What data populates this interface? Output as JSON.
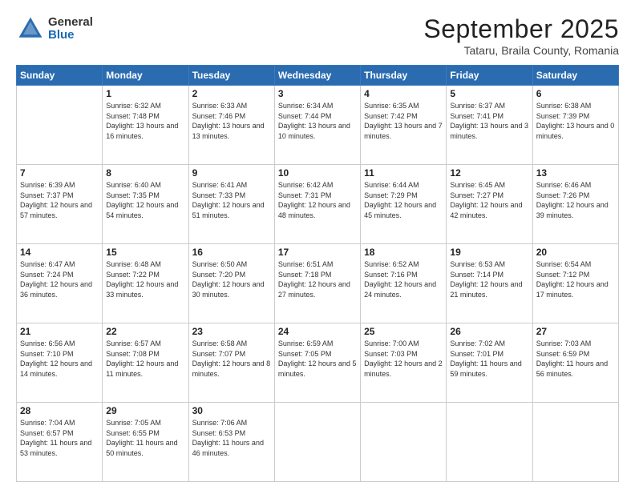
{
  "header": {
    "logo_general": "General",
    "logo_blue": "Blue",
    "month_title": "September 2025",
    "location": "Tataru, Braila County, Romania"
  },
  "weekdays": [
    "Sunday",
    "Monday",
    "Tuesday",
    "Wednesday",
    "Thursday",
    "Friday",
    "Saturday"
  ],
  "weeks": [
    [
      {
        "day": "",
        "sunrise": "",
        "sunset": "",
        "daylight": ""
      },
      {
        "day": "1",
        "sunrise": "Sunrise: 6:32 AM",
        "sunset": "Sunset: 7:48 PM",
        "daylight": "Daylight: 13 hours and 16 minutes."
      },
      {
        "day": "2",
        "sunrise": "Sunrise: 6:33 AM",
        "sunset": "Sunset: 7:46 PM",
        "daylight": "Daylight: 13 hours and 13 minutes."
      },
      {
        "day": "3",
        "sunrise": "Sunrise: 6:34 AM",
        "sunset": "Sunset: 7:44 PM",
        "daylight": "Daylight: 13 hours and 10 minutes."
      },
      {
        "day": "4",
        "sunrise": "Sunrise: 6:35 AM",
        "sunset": "Sunset: 7:42 PM",
        "daylight": "Daylight: 13 hours and 7 minutes."
      },
      {
        "day": "5",
        "sunrise": "Sunrise: 6:37 AM",
        "sunset": "Sunset: 7:41 PM",
        "daylight": "Daylight: 13 hours and 3 minutes."
      },
      {
        "day": "6",
        "sunrise": "Sunrise: 6:38 AM",
        "sunset": "Sunset: 7:39 PM",
        "daylight": "Daylight: 13 hours and 0 minutes."
      }
    ],
    [
      {
        "day": "7",
        "sunrise": "Sunrise: 6:39 AM",
        "sunset": "Sunset: 7:37 PM",
        "daylight": "Daylight: 12 hours and 57 minutes."
      },
      {
        "day": "8",
        "sunrise": "Sunrise: 6:40 AM",
        "sunset": "Sunset: 7:35 PM",
        "daylight": "Daylight: 12 hours and 54 minutes."
      },
      {
        "day": "9",
        "sunrise": "Sunrise: 6:41 AM",
        "sunset": "Sunset: 7:33 PM",
        "daylight": "Daylight: 12 hours and 51 minutes."
      },
      {
        "day": "10",
        "sunrise": "Sunrise: 6:42 AM",
        "sunset": "Sunset: 7:31 PM",
        "daylight": "Daylight: 12 hours and 48 minutes."
      },
      {
        "day": "11",
        "sunrise": "Sunrise: 6:44 AM",
        "sunset": "Sunset: 7:29 PM",
        "daylight": "Daylight: 12 hours and 45 minutes."
      },
      {
        "day": "12",
        "sunrise": "Sunrise: 6:45 AM",
        "sunset": "Sunset: 7:27 PM",
        "daylight": "Daylight: 12 hours and 42 minutes."
      },
      {
        "day": "13",
        "sunrise": "Sunrise: 6:46 AM",
        "sunset": "Sunset: 7:26 PM",
        "daylight": "Daylight: 12 hours and 39 minutes."
      }
    ],
    [
      {
        "day": "14",
        "sunrise": "Sunrise: 6:47 AM",
        "sunset": "Sunset: 7:24 PM",
        "daylight": "Daylight: 12 hours and 36 minutes."
      },
      {
        "day": "15",
        "sunrise": "Sunrise: 6:48 AM",
        "sunset": "Sunset: 7:22 PM",
        "daylight": "Daylight: 12 hours and 33 minutes."
      },
      {
        "day": "16",
        "sunrise": "Sunrise: 6:50 AM",
        "sunset": "Sunset: 7:20 PM",
        "daylight": "Daylight: 12 hours and 30 minutes."
      },
      {
        "day": "17",
        "sunrise": "Sunrise: 6:51 AM",
        "sunset": "Sunset: 7:18 PM",
        "daylight": "Daylight: 12 hours and 27 minutes."
      },
      {
        "day": "18",
        "sunrise": "Sunrise: 6:52 AM",
        "sunset": "Sunset: 7:16 PM",
        "daylight": "Daylight: 12 hours and 24 minutes."
      },
      {
        "day": "19",
        "sunrise": "Sunrise: 6:53 AM",
        "sunset": "Sunset: 7:14 PM",
        "daylight": "Daylight: 12 hours and 21 minutes."
      },
      {
        "day": "20",
        "sunrise": "Sunrise: 6:54 AM",
        "sunset": "Sunset: 7:12 PM",
        "daylight": "Daylight: 12 hours and 17 minutes."
      }
    ],
    [
      {
        "day": "21",
        "sunrise": "Sunrise: 6:56 AM",
        "sunset": "Sunset: 7:10 PM",
        "daylight": "Daylight: 12 hours and 14 minutes."
      },
      {
        "day": "22",
        "sunrise": "Sunrise: 6:57 AM",
        "sunset": "Sunset: 7:08 PM",
        "daylight": "Daylight: 12 hours and 11 minutes."
      },
      {
        "day": "23",
        "sunrise": "Sunrise: 6:58 AM",
        "sunset": "Sunset: 7:07 PM",
        "daylight": "Daylight: 12 hours and 8 minutes."
      },
      {
        "day": "24",
        "sunrise": "Sunrise: 6:59 AM",
        "sunset": "Sunset: 7:05 PM",
        "daylight": "Daylight: 12 hours and 5 minutes."
      },
      {
        "day": "25",
        "sunrise": "Sunrise: 7:00 AM",
        "sunset": "Sunset: 7:03 PM",
        "daylight": "Daylight: 12 hours and 2 minutes."
      },
      {
        "day": "26",
        "sunrise": "Sunrise: 7:02 AM",
        "sunset": "Sunset: 7:01 PM",
        "daylight": "Daylight: 11 hours and 59 minutes."
      },
      {
        "day": "27",
        "sunrise": "Sunrise: 7:03 AM",
        "sunset": "Sunset: 6:59 PM",
        "daylight": "Daylight: 11 hours and 56 minutes."
      }
    ],
    [
      {
        "day": "28",
        "sunrise": "Sunrise: 7:04 AM",
        "sunset": "Sunset: 6:57 PM",
        "daylight": "Daylight: 11 hours and 53 minutes."
      },
      {
        "day": "29",
        "sunrise": "Sunrise: 7:05 AM",
        "sunset": "Sunset: 6:55 PM",
        "daylight": "Daylight: 11 hours and 50 minutes."
      },
      {
        "day": "30",
        "sunrise": "Sunrise: 7:06 AM",
        "sunset": "Sunset: 6:53 PM",
        "daylight": "Daylight: 11 hours and 46 minutes."
      },
      {
        "day": "",
        "sunrise": "",
        "sunset": "",
        "daylight": ""
      },
      {
        "day": "",
        "sunrise": "",
        "sunset": "",
        "daylight": ""
      },
      {
        "day": "",
        "sunrise": "",
        "sunset": "",
        "daylight": ""
      },
      {
        "day": "",
        "sunrise": "",
        "sunset": "",
        "daylight": ""
      }
    ]
  ]
}
